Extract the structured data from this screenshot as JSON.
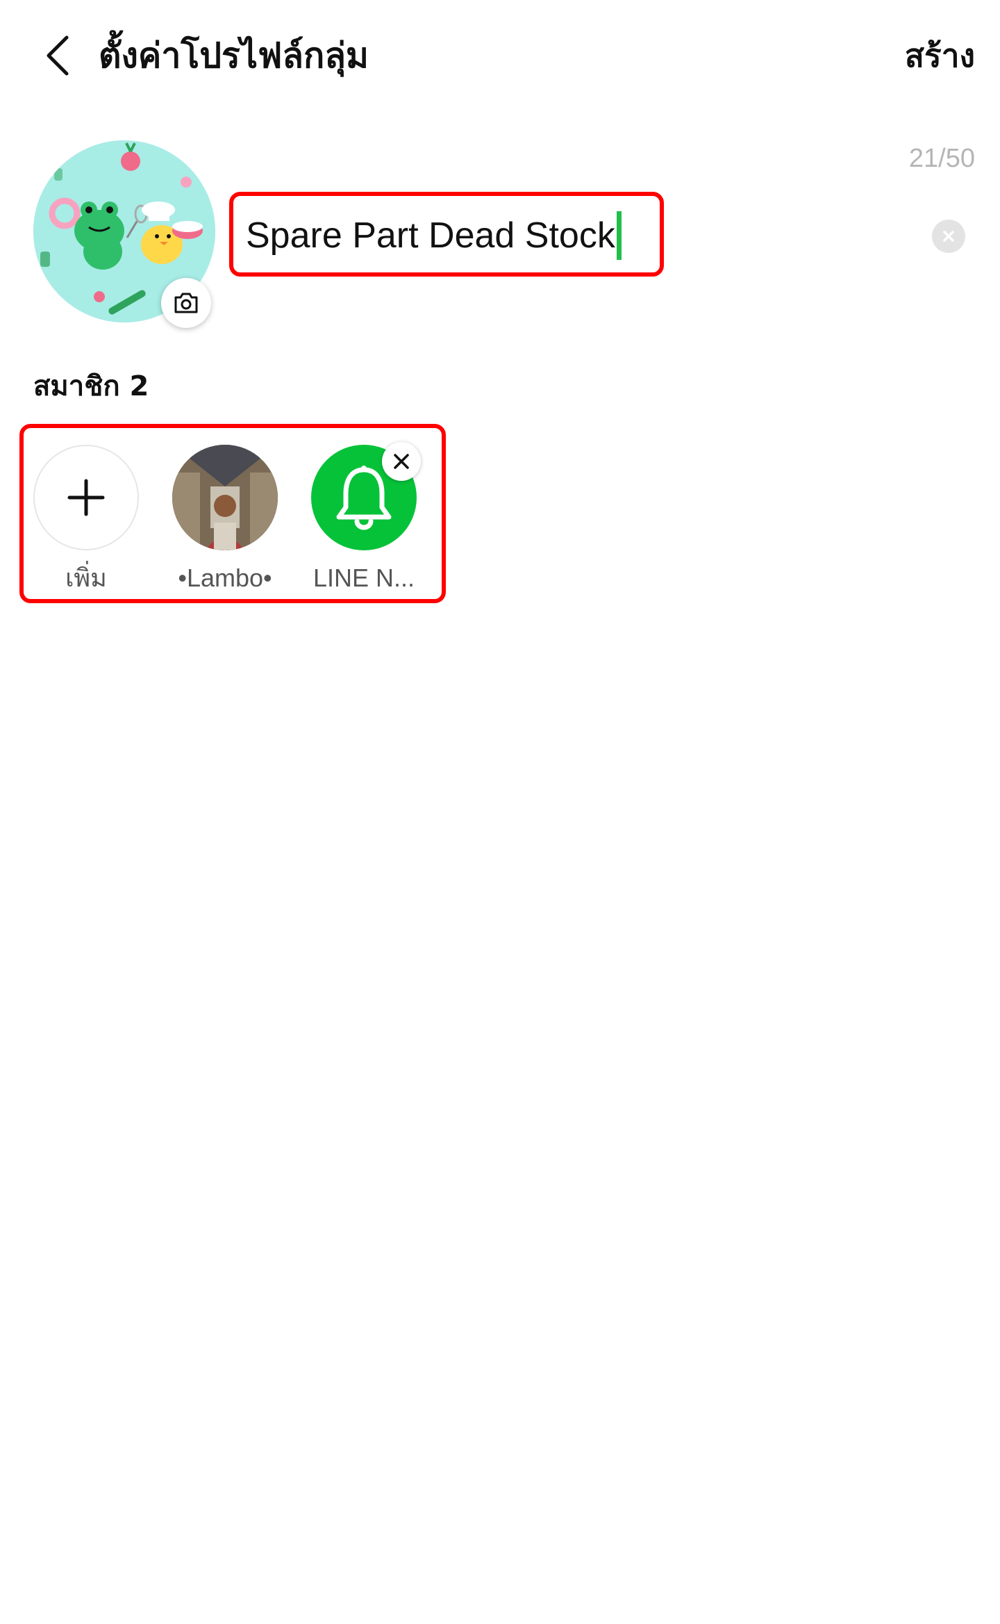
{
  "header": {
    "title": "ตั้งค่าโปรไฟล์กลุ่ม",
    "create_label": "สร้าง"
  },
  "profile": {
    "name_value": "Spare Part Dead Stock",
    "char_counter": "21/50",
    "avatar_colors": {
      "background": "#a8ece6",
      "frog": "#2fbf6a",
      "chick": "#ffd84a"
    }
  },
  "members": {
    "label": "สมาชิก 2",
    "items": [
      {
        "name": "เพิ่ม",
        "kind": "add",
        "icon": "plus-icon"
      },
      {
        "name": "•Lambo•",
        "kind": "photo"
      },
      {
        "name": "LINE N...",
        "kind": "bell",
        "icon": "bell-icon",
        "color": "#06c239"
      }
    ]
  },
  "colors": {
    "highlight": "#ff0000",
    "accent": "#06c239",
    "caret": "#1fbf4a"
  }
}
